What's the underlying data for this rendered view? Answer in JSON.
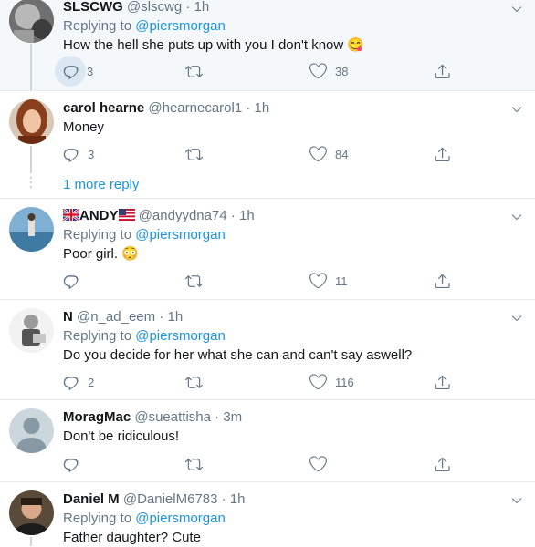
{
  "colors": {
    "accent": "#1b95e0",
    "muted": "#657786",
    "text": "#14171a",
    "separator": "#e6ecf0",
    "highlight_bg": "#f5f8fa"
  },
  "tweets": [
    {
      "name": "SLSCWG",
      "handle": "@slscwg",
      "dot": "·",
      "time": "1h",
      "replying_prefix": "Replying to",
      "replying_to": "@piersmorgan",
      "text": "How the hell she puts up with you I don't know",
      "emoji": "😋",
      "reply_count": "3",
      "retweet_count": "",
      "like_count": "38"
    },
    {
      "name": "carol hearne",
      "handle": "@hearnecarol1",
      "dot": "·",
      "time": "1h",
      "text": "Money",
      "reply_count": "3",
      "retweet_count": "",
      "like_count": "84",
      "more_replies": "1 more reply"
    },
    {
      "name": "ANDY",
      "handle": "@andyydna74",
      "dot": "·",
      "time": "1h",
      "replying_prefix": "Replying to",
      "replying_to": "@piersmorgan",
      "text": "Poor girl.",
      "emoji": "😳",
      "reply_count": "",
      "retweet_count": "",
      "like_count": "11"
    },
    {
      "name": "N",
      "handle": "@n_ad_eem",
      "dot": "·",
      "time": "1h",
      "replying_prefix": "Replying to",
      "replying_to": "@piersmorgan",
      "text": "Do you decide for her what she can and can't say aswell?",
      "reply_count": "2",
      "retweet_count": "",
      "like_count": "116"
    },
    {
      "name": "MoragMac",
      "handle": "@sueattisha",
      "dot": "·",
      "time": "3m",
      "text": "Don't be ridiculous!",
      "reply_count": "",
      "retweet_count": "",
      "like_count": ""
    },
    {
      "name": "Daniel M",
      "handle": "@DanielM6783",
      "dot": "·",
      "time": "1h",
      "replying_prefix": "Replying to",
      "replying_to": "@piersmorgan",
      "text": "Father daughter? Cute"
    }
  ],
  "icons": {
    "reply": "reply-icon",
    "retweet": "retweet-icon",
    "like": "heart-icon",
    "share": "share-icon",
    "more": "chevron-down-icon"
  }
}
